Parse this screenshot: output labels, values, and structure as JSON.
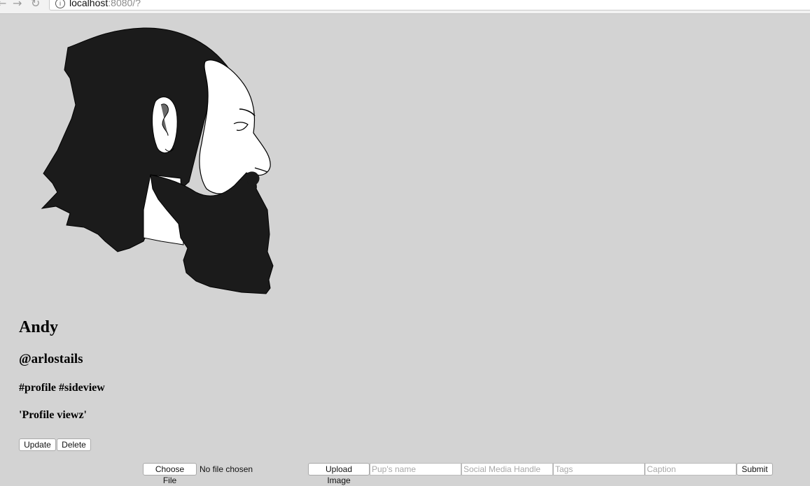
{
  "browser": {
    "url_host": "localhost",
    "url_rest": ":8080/?"
  },
  "profile": {
    "name": "Andy",
    "handle": "@arlostails",
    "tags": "#profile #sideview",
    "caption": "'Profile viewz'",
    "update_label": "Update",
    "delete_label": "Delete"
  },
  "upload_form": {
    "choose_file_label": "Choose File",
    "file_status": "No file chosen",
    "upload_label": "Upload Image",
    "name_placeholder": "Pup's name",
    "social_placeholder": "Social Media Handle",
    "tags_placeholder": "Tags",
    "caption_placeholder": "Caption",
    "submit_label": "Submit"
  },
  "icons": {
    "back": "arrow-left-icon",
    "forward": "arrow-right-icon",
    "reload": "reload-icon",
    "info": "info-icon"
  }
}
